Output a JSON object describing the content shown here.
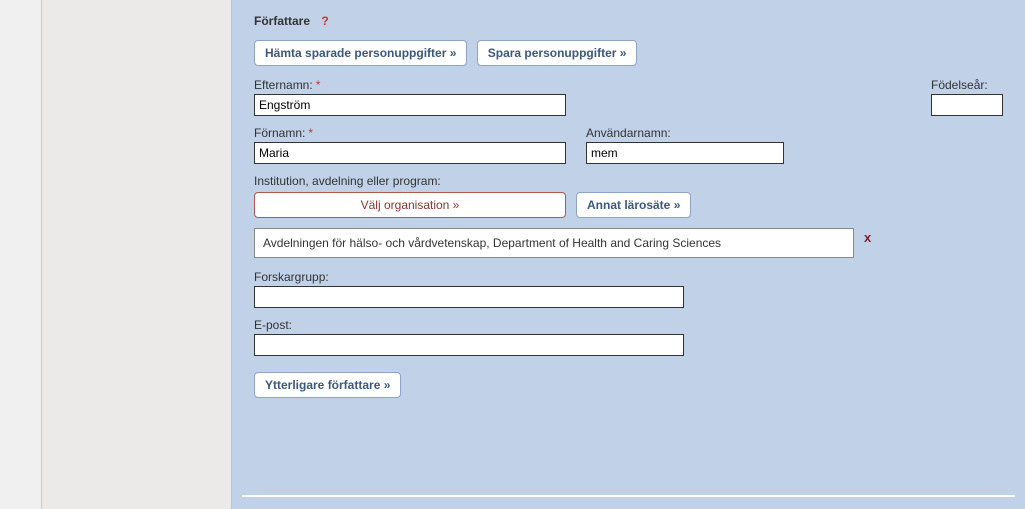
{
  "title": "Författare",
  "help_icon": "?",
  "buttons": {
    "fetch_saved": "Hämta sparade personuppgifter »",
    "save_personal": "Spara personuppgifter »",
    "choose_org": "Välj organisation »",
    "other_uni": "Annat lärosäte »",
    "more_authors": "Ytterligare författare »"
  },
  "labels": {
    "lastname": "Efternamn:",
    "birthyear": "Födelseår:",
    "firstname": "Förnamn:",
    "username": "Användarnamn:",
    "institution": "Institution, avdelning eller program:",
    "researchgroup": "Forskargrupp:",
    "email": "E-post:"
  },
  "values": {
    "lastname": "Engström",
    "birthyear": "",
    "firstname": "Maria",
    "username": "mem",
    "researchgroup": "",
    "email": ""
  },
  "organisation": "Avdelningen för hälso- och vårdvetenskap, Department of Health and Caring Sciences",
  "delete_symbol": "x"
}
